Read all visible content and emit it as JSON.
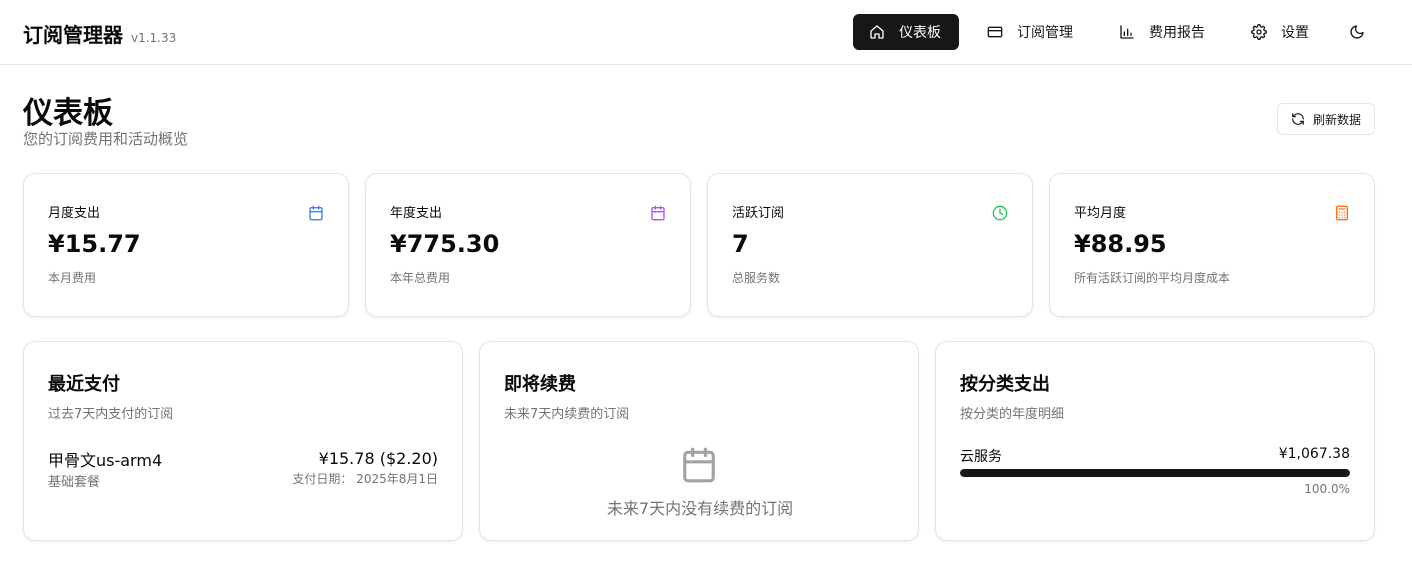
{
  "app": {
    "title": "订阅管理器",
    "version": "v1.1.33"
  },
  "nav": {
    "dashboard": "仪表板",
    "subscriptions": "订阅管理",
    "reports": "费用报告",
    "settings": "设置"
  },
  "page": {
    "title": "仪表板",
    "subtitle": "您的订阅费用和活动概览",
    "refresh_label": "刷新数据"
  },
  "stats": [
    {
      "label": "月度支出",
      "value": "¥15.77",
      "note": "本月费用",
      "icon": "calendar-icon",
      "color": "#3b82f6"
    },
    {
      "label": "年度支出",
      "value": "¥775.30",
      "note": "本年总费用",
      "icon": "calendar-icon",
      "color": "#a855f7"
    },
    {
      "label": "活跃订阅",
      "value": "7",
      "note": "总服务数",
      "icon": "clock-icon",
      "color": "#22c55e"
    },
    {
      "label": "平均月度",
      "value": "¥88.95",
      "note": "所有活跃订阅的平均月度成本",
      "icon": "calculator-icon",
      "color": "#f97316"
    }
  ],
  "recent_payments": {
    "title": "最近支付",
    "subtitle": "过去7天内支付的订阅",
    "items": [
      {
        "name": "甲骨文us-arm4",
        "plan": "基础套餐",
        "amount": "¥15.78 ($2.20)",
        "date": "支付日期： 2025年8月1日"
      }
    ]
  },
  "upcoming": {
    "title": "即将续费",
    "subtitle": "未来7天内续费的订阅",
    "empty_text": "未来7天内没有续费的订阅"
  },
  "by_category": {
    "title": "按分类支出",
    "subtitle": "按分类的年度明细",
    "items": [
      {
        "name": "云服务",
        "amount": "¥1,067.38",
        "percent_label": "100.0%",
        "fraction": 1.0
      }
    ]
  }
}
